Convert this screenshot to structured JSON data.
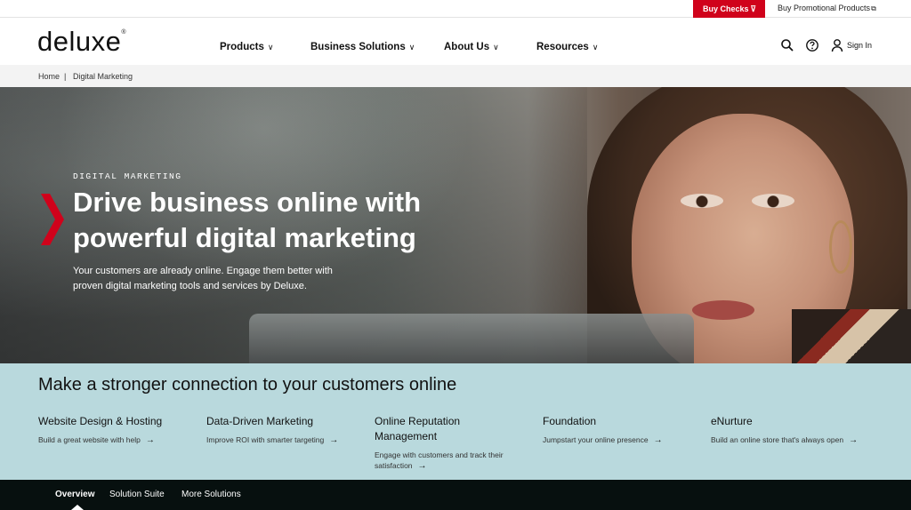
{
  "utility": {
    "buy_checks": "Buy Checks",
    "buy_checks_bg": "#d0021b",
    "promo": "Buy Promotional Products",
    "promo_icon": "external-link-icon"
  },
  "header": {
    "logo": "deluxe",
    "nav": [
      {
        "label": "Products"
      },
      {
        "label": "Business Solutions"
      },
      {
        "label": "About Us"
      },
      {
        "label": "Resources"
      }
    ],
    "icons": [
      "search-icon",
      "help-icon",
      "user-icon"
    ],
    "signin": "Sign In"
  },
  "breadcrumb": {
    "home": "Home",
    "separator": "|",
    "current": "Digital Marketing"
  },
  "hero": {
    "eyebrow": "DIGITAL MARKETING",
    "title_line1": "Drive business online with",
    "title_line2": "powerful digital marketing",
    "subtitle": "Your customers are already online. Engage them better with proven digital marketing tools and services by Deluxe.",
    "accent": "#d0021b"
  },
  "connect": {
    "heading": "Make a stronger connection to your customers online",
    "bg": "#b9d9dd",
    "features": [
      {
        "title": "Website Design & Hosting",
        "desc": "Build a great website with help"
      },
      {
        "title": "Data-Driven Marketing",
        "desc": "Improve ROI with smarter targeting"
      },
      {
        "title": "Online Reputation Management",
        "desc": "Engage with customers and track their satisfaction"
      },
      {
        "title": "Foundation",
        "desc": "Jumpstart your online presence"
      },
      {
        "title": "eNurture",
        "desc": "Build an online store that's always open"
      }
    ]
  },
  "tabs": {
    "items": [
      {
        "label": "Overview",
        "active": true
      },
      {
        "label": "Solution Suite",
        "active": false
      },
      {
        "label": "More Solutions",
        "active": false
      }
    ]
  }
}
